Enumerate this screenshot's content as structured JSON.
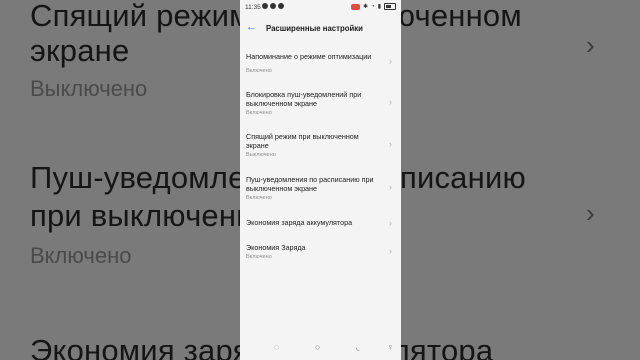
{
  "background": {
    "lines": [
      {
        "text": "Спящий режим при выключенном"
      },
      {
        "text": "экране"
      },
      {
        "text": "Выключено"
      },
      {
        "text": "Пуш-уведомления по расписанию"
      },
      {
        "text": "при выключенном экране"
      },
      {
        "text": "Включено"
      },
      {
        "text": "Экономия заряда аккумулятора"
      }
    ]
  },
  "status_bar": {
    "time": "11:35"
  },
  "header": {
    "title": "Расширенные настройки",
    "back_icon": "arrow-left-icon"
  },
  "items": [
    {
      "label": "Напоминание о режиме оптимизации",
      "status": "Включено"
    },
    {
      "label": "Блокировка пуш-уведомлений при выключенном экране",
      "status": "Включено"
    },
    {
      "label": "Спящий режим при выключенном экране",
      "status": "Выключено"
    },
    {
      "label": "Пуш-уведомления по расписанию при выключенном экране",
      "status": "Включено"
    },
    {
      "label": "Экономия заряда аккумулятора",
      "status": ""
    },
    {
      "label": "Экономия Заряда",
      "status": "Включено"
    }
  ],
  "chevron": "›",
  "nav": {
    "icons": [
      "recent-icon",
      "home-icon",
      "back-icon",
      "accessibility-icon"
    ]
  }
}
